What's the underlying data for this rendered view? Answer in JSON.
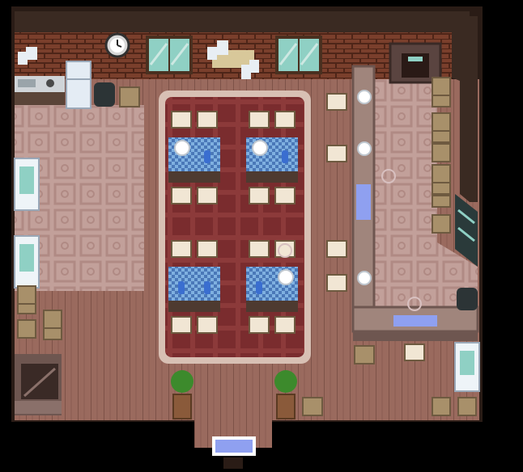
{
  "map": {
    "name": "",
    "colors": {
      "void": "#000000",
      "wall_trim": "#2a1c16",
      "brick": "#7a3f2c",
      "brick_mortar": "#4e2518",
      "floor_wood": "#9a6a5e",
      "floor_wood_line": "#7d5248",
      "floor_tile": "#c2a09a",
      "tile_pattern": "#b08a84",
      "rug_border": "#d8c0b4",
      "rug_main": "#7a2c2e",
      "rug_stripe": "#8c3a3a",
      "counter_top": "#a0857c",
      "counter_edge": "#6e5650",
      "table_cloth": "#7fb0e0",
      "table_cloth_check": "#4a78b8",
      "stool_seat": "#f1e6d4",
      "crate": "#a8906a",
      "window_glass": "#8fd0c4",
      "plant_leaf": "#3c8a2c",
      "pot": "#8a5a3a",
      "doormat": "#8fa0f0"
    },
    "objects": {
      "wall_clock": "clock-icon",
      "kitchen_stove": "stove-icon",
      "fridge": "fridge-icon",
      "trash_bin": "trash-bin-icon",
      "notice_board": "notice-board-icon",
      "fireplace": "fireplace-icon",
      "stairs": "stairs-icon",
      "plant": "potted-plant-icon",
      "vending_machine": "vending-machine-icon",
      "exit_mat": "doormat-icon"
    }
  }
}
